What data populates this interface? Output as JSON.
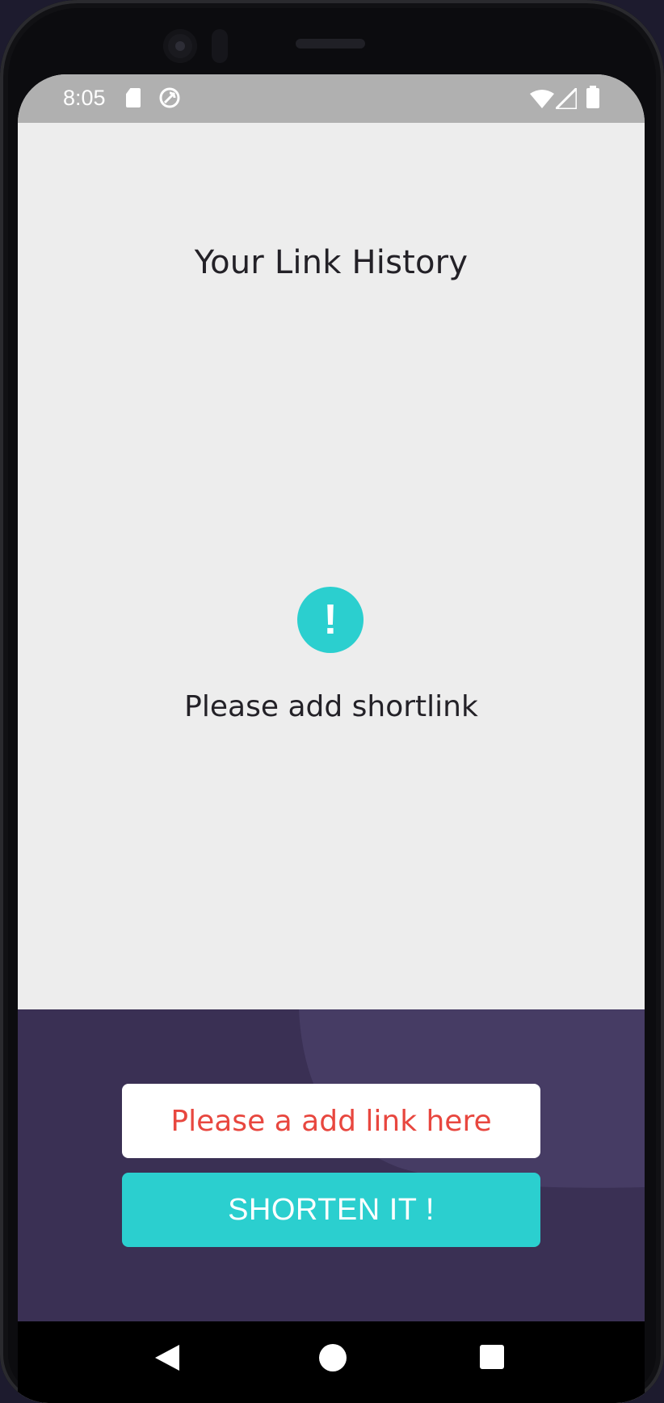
{
  "status_bar": {
    "time": "8:05",
    "icons": [
      "sd-card-icon",
      "sync-icon",
      "wifi-icon",
      "signal-icon",
      "battery-icon"
    ]
  },
  "history": {
    "title": "Your Link History",
    "empty_icon_glyph": "!",
    "empty_message": "Please add shortlink"
  },
  "form": {
    "input_placeholder": "Please a add link here",
    "input_value": "",
    "button_label": "SHORTEN IT !"
  },
  "navigation": {
    "icons": [
      "back-icon",
      "home-icon",
      "recents-icon"
    ]
  },
  "colors": {
    "accent": "#2bcfcf",
    "panel": "#3a3054",
    "panel_shape": "#463c64",
    "error_text": "#e8473f",
    "background": "#ededed"
  }
}
